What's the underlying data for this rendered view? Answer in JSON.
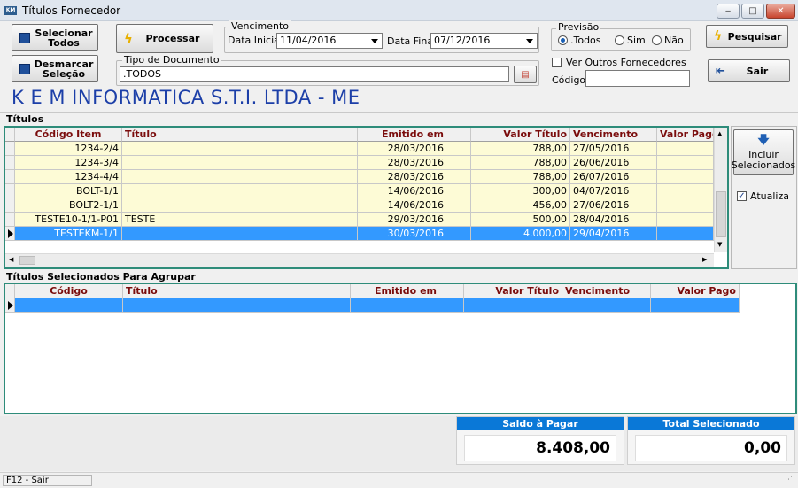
{
  "window": {
    "title": "Títulos Fornecedor",
    "app_icon_text": "KM",
    "minimize": "‒",
    "maximize": "□",
    "close": "✕"
  },
  "buttons": {
    "select_all": "Selecionar Todos",
    "deselect": "Desmarcar Seleção",
    "process": "Processar",
    "search": "Pesquisar",
    "exit": "Sair",
    "include": "Incluir Selecionados"
  },
  "vencimento": {
    "title": "Vencimento",
    "start_label": "Data Inicial",
    "start_value": "11/04/2016",
    "end_label": "Data Final",
    "end_value": "07/12/2016"
  },
  "previsao": {
    "title": "Previsão",
    "options": [
      ".Todos",
      "Sim",
      "Não"
    ],
    "selected": ".Todos"
  },
  "tipo_documento": {
    "title": "Tipo de Documento",
    "value": ".TODOS"
  },
  "outros_fornecedores": {
    "label": "Ver Outros Fornecedores",
    "checked": false
  },
  "codigo": {
    "label": "Código:",
    "value": ""
  },
  "company_name": "K E M INFORMATICA S.T.I. LTDA - ME",
  "titulos": {
    "section_title": "Títulos",
    "columns": [
      "Código Item",
      "Título",
      "Emitido em",
      "Valor Título",
      "Vencimento",
      "Valor Pago"
    ],
    "rows": [
      [
        "1234-2/4",
        "",
        "28/03/2016",
        "788,00",
        "27/05/2016",
        ""
      ],
      [
        "1234-3/4",
        "",
        "28/03/2016",
        "788,00",
        "26/06/2016",
        ""
      ],
      [
        "1234-4/4",
        "",
        "28/03/2016",
        "788,00",
        "26/07/2016",
        ""
      ],
      [
        "BOLT-1/1",
        "",
        "14/06/2016",
        "300,00",
        "04/07/2016",
        ""
      ],
      [
        "BOLT2-1/1",
        "",
        "14/06/2016",
        "456,00",
        "27/06/2016",
        ""
      ],
      [
        "TESTE10-1/1-P01",
        "TESTE",
        "29/03/2016",
        "500,00",
        "28/04/2016",
        ""
      ],
      [
        "TESTEKM-1/1",
        "",
        "30/03/2016",
        "4.000,00",
        "29/04/2016",
        ""
      ]
    ]
  },
  "atualiza": {
    "label": "Atualiza",
    "checked": true
  },
  "agrupar": {
    "section_title": "Títulos Selecionados Para Agrupar",
    "columns": [
      "Código",
      "Título",
      "Emitido em",
      "Valor Título",
      "Vencimento",
      "Valor Pago"
    ]
  },
  "totals": {
    "saldo_label": "Saldo à Pagar",
    "saldo_value": "8.408,00",
    "total_label": "Total Selecionado",
    "total_value": "0,00"
  },
  "status": {
    "text": "F12 - Sair"
  },
  "colors": {
    "grid_border": "#2e8c7a",
    "header_text": "#7a0c0c",
    "selection": "#3399ff",
    "company": "#1c3fa8",
    "total_header": "#0a78d7"
  }
}
